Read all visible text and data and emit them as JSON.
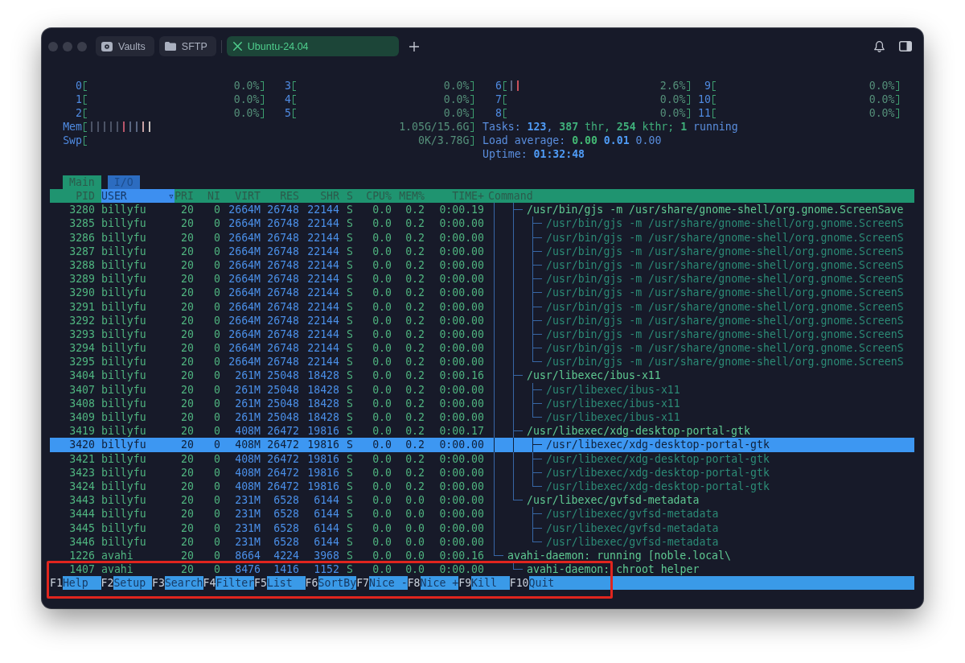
{
  "window": {
    "tabs": [
      {
        "label": "Vaults",
        "kind": "vaults",
        "selected": false
      },
      {
        "label": "SFTP",
        "kind": "sftp",
        "selected": false
      },
      {
        "label": "Ubuntu-24.04",
        "kind": "host",
        "selected": true
      }
    ]
  },
  "meters": {
    "cpus": [
      {
        "label": "0",
        "value": "0.0%"
      },
      {
        "label": "3",
        "value": "0.0%"
      },
      {
        "label": "6",
        "value": "2.6%",
        "bars": [
          {
            "color": "#5d6680"
          },
          {
            "color": "#c8505a"
          }
        ]
      },
      {
        "label": "9",
        "value": "0.0%"
      },
      {
        "label": "1",
        "value": "0.0%"
      },
      {
        "label": "4",
        "value": "0.0%"
      },
      {
        "label": "7",
        "value": "0.0%"
      },
      {
        "label": "10",
        "value": "0.0%"
      },
      {
        "label": "2",
        "value": "0.0%"
      },
      {
        "label": "5",
        "value": "0.0%"
      },
      {
        "label": "8",
        "value": "0.0%"
      },
      {
        "label": "11",
        "value": "0.0%"
      }
    ],
    "memory": {
      "label": "Mem",
      "value": "1.05G/15.6G",
      "bars": [
        {
          "color": "#4c5366"
        },
        {
          "color": "#4c5366"
        },
        {
          "color": "#4c5366"
        },
        {
          "color": "#4c5366"
        },
        {
          "color": "#4c5366"
        },
        {
          "color": "#b8556a"
        },
        {
          "color": "#5a6680"
        },
        {
          "color": "#5a6680"
        },
        {
          "color": "#c9a2a4"
        },
        {
          "color": "#c8c0bc"
        }
      ]
    },
    "swap": {
      "label": "Swp",
      "value": "0K/3.78G"
    }
  },
  "summary": [
    {
      "parts": [
        {
          "kind": "label",
          "text": "Tasks: "
        },
        {
          "kind": "total",
          "text": "123"
        },
        {
          "kind": "label",
          "text": ", "
        },
        {
          "kind": "threads",
          "text": "387"
        },
        {
          "kind": "threads_label",
          "text": " thr, "
        },
        {
          "kind": "threads",
          "text": "254"
        },
        {
          "kind": "threads_label",
          "text": " kthr; "
        },
        {
          "kind": "running",
          "text": "1"
        },
        {
          "kind": "label",
          "text": " running"
        }
      ]
    },
    {
      "parts": [
        {
          "kind": "label",
          "text": "Load average: "
        },
        {
          "kind": "load_high",
          "text": "0.00"
        },
        {
          "kind": "load_mid",
          "text": " 0.01"
        },
        {
          "kind": "load_low",
          "text": " 0.00"
        }
      ]
    },
    {
      "parts": [
        {
          "kind": "label",
          "text": "Uptime: "
        },
        {
          "kind": "total",
          "text": "01:32:48"
        }
      ]
    }
  ],
  "screen_tabs": [
    {
      "label": "Main",
      "selected": true
    },
    {
      "label": "I/O",
      "selected": false
    }
  ],
  "columns": [
    {
      "label": "PID",
      "sorted": false
    },
    {
      "label": "USER",
      "sorted": true,
      "sort_mark": "▿"
    },
    {
      "label": "PRI",
      "sorted": false
    },
    {
      "label": "NI",
      "sorted": false
    },
    {
      "label": "VIRT",
      "sorted": false
    },
    {
      "label": "RES",
      "sorted": false
    },
    {
      "label": "SHR",
      "sorted": false
    },
    {
      "label": "S",
      "sorted": false
    },
    {
      "label": "CPU%",
      "sorted": false
    },
    {
      "label": "MEM%",
      "sorted": false
    },
    {
      "label": "TIME+",
      "sorted": false
    },
    {
      "label": "Command",
      "sorted": false
    }
  ],
  "processes": [
    {
      "children": [
        {
          "pid": "3280",
          "user": "billyfu",
          "priority": "20",
          "nice": "0",
          "virt": "2664M",
          "res": "26748",
          "shr": "22144",
          "state": "S",
          "cpu": "0.0",
          "mem": "0.2",
          "time": "0:00.19",
          "command": "/usr/bin/gjs -m /usr/share/gnome-shell/org.gnome.ScreenSave",
          "thread": false,
          "selected": false,
          "children": [
            {
              "pid": "3285",
              "user": "billyfu",
              "priority": "20",
              "nice": "0",
              "virt": "2664M",
              "res": "26748",
              "shr": "22144",
              "state": "S",
              "cpu": "0.0",
              "mem": "0.2",
              "time": "0:00.00",
              "command": "/usr/bin/gjs -m /usr/share/gnome-shell/org.gnome.ScreenS",
              "thread": true,
              "selected": false
            },
            {
              "pid": "3286",
              "user": "billyfu",
              "priority": "20",
              "nice": "0",
              "virt": "2664M",
              "res": "26748",
              "shr": "22144",
              "state": "S",
              "cpu": "0.0",
              "mem": "0.2",
              "time": "0:00.00",
              "command": "/usr/bin/gjs -m /usr/share/gnome-shell/org.gnome.ScreenS",
              "thread": true,
              "selected": false
            },
            {
              "pid": "3287",
              "user": "billyfu",
              "priority": "20",
              "nice": "0",
              "virt": "2664M",
              "res": "26748",
              "shr": "22144",
              "state": "S",
              "cpu": "0.0",
              "mem": "0.2",
              "time": "0:00.00",
              "command": "/usr/bin/gjs -m /usr/share/gnome-shell/org.gnome.ScreenS",
              "thread": true,
              "selected": false
            },
            {
              "pid": "3288",
              "user": "billyfu",
              "priority": "20",
              "nice": "0",
              "virt": "2664M",
              "res": "26748",
              "shr": "22144",
              "state": "S",
              "cpu": "0.0",
              "mem": "0.2",
              "time": "0:00.00",
              "command": "/usr/bin/gjs -m /usr/share/gnome-shell/org.gnome.ScreenS",
              "thread": true,
              "selected": false
            },
            {
              "pid": "3289",
              "user": "billyfu",
              "priority": "20",
              "nice": "0",
              "virt": "2664M",
              "res": "26748",
              "shr": "22144",
              "state": "S",
              "cpu": "0.0",
              "mem": "0.2",
              "time": "0:00.00",
              "command": "/usr/bin/gjs -m /usr/share/gnome-shell/org.gnome.ScreenS",
              "thread": true,
              "selected": false
            },
            {
              "pid": "3290",
              "user": "billyfu",
              "priority": "20",
              "nice": "0",
              "virt": "2664M",
              "res": "26748",
              "shr": "22144",
              "state": "S",
              "cpu": "0.0",
              "mem": "0.2",
              "time": "0:00.00",
              "command": "/usr/bin/gjs -m /usr/share/gnome-shell/org.gnome.ScreenS",
              "thread": true,
              "selected": false
            },
            {
              "pid": "3291",
              "user": "billyfu",
              "priority": "20",
              "nice": "0",
              "virt": "2664M",
              "res": "26748",
              "shr": "22144",
              "state": "S",
              "cpu": "0.0",
              "mem": "0.2",
              "time": "0:00.00",
              "command": "/usr/bin/gjs -m /usr/share/gnome-shell/org.gnome.ScreenS",
              "thread": true,
              "selected": false
            },
            {
              "pid": "3292",
              "user": "billyfu",
              "priority": "20",
              "nice": "0",
              "virt": "2664M",
              "res": "26748",
              "shr": "22144",
              "state": "S",
              "cpu": "0.0",
              "mem": "0.2",
              "time": "0:00.00",
              "command": "/usr/bin/gjs -m /usr/share/gnome-shell/org.gnome.ScreenS",
              "thread": true,
              "selected": false
            },
            {
              "pid": "3293",
              "user": "billyfu",
              "priority": "20",
              "nice": "0",
              "virt": "2664M",
              "res": "26748",
              "shr": "22144",
              "state": "S",
              "cpu": "0.0",
              "mem": "0.2",
              "time": "0:00.00",
              "command": "/usr/bin/gjs -m /usr/share/gnome-shell/org.gnome.ScreenS",
              "thread": true,
              "selected": false
            },
            {
              "pid": "3294",
              "user": "billyfu",
              "priority": "20",
              "nice": "0",
              "virt": "2664M",
              "res": "26748",
              "shr": "22144",
              "state": "S",
              "cpu": "0.0",
              "mem": "0.2",
              "time": "0:00.00",
              "command": "/usr/bin/gjs -m /usr/share/gnome-shell/org.gnome.ScreenS",
              "thread": true,
              "selected": false
            },
            {
              "pid": "3295",
              "user": "billyfu",
              "priority": "20",
              "nice": "0",
              "virt": "2664M",
              "res": "26748",
              "shr": "22144",
              "state": "S",
              "cpu": "0.0",
              "mem": "0.2",
              "time": "0:00.00",
              "command": "/usr/bin/gjs -m /usr/share/gnome-shell/org.gnome.ScreenS",
              "thread": true,
              "selected": false
            }
          ]
        },
        {
          "pid": "3404",
          "user": "billyfu",
          "priority": "20",
          "nice": "0",
          "virt": "261M",
          "res": "25048",
          "shr": "18428",
          "state": "S",
          "cpu": "0.0",
          "mem": "0.2",
          "time": "0:00.16",
          "command": "/usr/libexec/ibus-x11",
          "thread": false,
          "selected": false,
          "children": [
            {
              "pid": "3407",
              "user": "billyfu",
              "priority": "20",
              "nice": "0",
              "virt": "261M",
              "res": "25048",
              "shr": "18428",
              "state": "S",
              "cpu": "0.0",
              "mem": "0.2",
              "time": "0:00.00",
              "command": "/usr/libexec/ibus-x11",
              "thread": true,
              "selected": false
            },
            {
              "pid": "3408",
              "user": "billyfu",
              "priority": "20",
              "nice": "0",
              "virt": "261M",
              "res": "25048",
              "shr": "18428",
              "state": "S",
              "cpu": "0.0",
              "mem": "0.2",
              "time": "0:00.00",
              "command": "/usr/libexec/ibus-x11",
              "thread": true,
              "selected": false
            },
            {
              "pid": "3409",
              "user": "billyfu",
              "priority": "20",
              "nice": "0",
              "virt": "261M",
              "res": "25048",
              "shr": "18428",
              "state": "S",
              "cpu": "0.0",
              "mem": "0.2",
              "time": "0:00.00",
              "command": "/usr/libexec/ibus-x11",
              "thread": true,
              "selected": false
            }
          ]
        },
        {
          "pid": "3419",
          "user": "billyfu",
          "priority": "20",
          "nice": "0",
          "virt": "408M",
          "res": "26472",
          "shr": "19816",
          "state": "S",
          "cpu": "0.0",
          "mem": "0.2",
          "time": "0:00.17",
          "command": "/usr/libexec/xdg-desktop-portal-gtk",
          "thread": false,
          "selected": false,
          "children": [
            {
              "pid": "3420",
              "user": "billyfu",
              "priority": "20",
              "nice": "0",
              "virt": "408M",
              "res": "26472",
              "shr": "19816",
              "state": "S",
              "cpu": "0.0",
              "mem": "0.2",
              "time": "0:00.00",
              "command": "/usr/libexec/xdg-desktop-portal-gtk",
              "thread": true,
              "selected": true
            },
            {
              "pid": "3421",
              "user": "billyfu",
              "priority": "20",
              "nice": "0",
              "virt": "408M",
              "res": "26472",
              "shr": "19816",
              "state": "S",
              "cpu": "0.0",
              "mem": "0.2",
              "time": "0:00.00",
              "command": "/usr/libexec/xdg-desktop-portal-gtk",
              "thread": true,
              "selected": false
            },
            {
              "pid": "3423",
              "user": "billyfu",
              "priority": "20",
              "nice": "0",
              "virt": "408M",
              "res": "26472",
              "shr": "19816",
              "state": "S",
              "cpu": "0.0",
              "mem": "0.2",
              "time": "0:00.00",
              "command": "/usr/libexec/xdg-desktop-portal-gtk",
              "thread": true,
              "selected": false
            },
            {
              "pid": "3424",
              "user": "billyfu",
              "priority": "20",
              "nice": "0",
              "virt": "408M",
              "res": "26472",
              "shr": "19816",
              "state": "S",
              "cpu": "0.0",
              "mem": "0.2",
              "time": "0:00.00",
              "command": "/usr/libexec/xdg-desktop-portal-gtk",
              "thread": true,
              "selected": false
            }
          ]
        },
        {
          "pid": "3443",
          "user": "billyfu",
          "priority": "20",
          "nice": "0",
          "virt": "231M",
          "res": "6528",
          "shr": "6144",
          "state": "S",
          "cpu": "0.0",
          "mem": "0.0",
          "time": "0:00.00",
          "command": "/usr/libexec/gvfsd-metadata",
          "thread": false,
          "selected": false,
          "children": [
            {
              "pid": "3444",
              "user": "billyfu",
              "priority": "20",
              "nice": "0",
              "virt": "231M",
              "res": "6528",
              "shr": "6144",
              "state": "S",
              "cpu": "0.0",
              "mem": "0.0",
              "time": "0:00.00",
              "command": "/usr/libexec/gvfsd-metadata",
              "thread": true,
              "selected": false
            },
            {
              "pid": "3445",
              "user": "billyfu",
              "priority": "20",
              "nice": "0",
              "virt": "231M",
              "res": "6528",
              "shr": "6144",
              "state": "S",
              "cpu": "0.0",
              "mem": "0.0",
              "time": "0:00.00",
              "command": "/usr/libexec/gvfsd-metadata",
              "thread": true,
              "selected": false
            },
            {
              "pid": "3446",
              "user": "billyfu",
              "priority": "20",
              "nice": "0",
              "virt": "231M",
              "res": "6528",
              "shr": "6144",
              "state": "S",
              "cpu": "0.0",
              "mem": "0.0",
              "time": "0:00.00",
              "command": "/usr/libexec/gvfsd-metadata",
              "thread": true,
              "selected": false
            }
          ]
        }
      ]
    },
    {
      "pid": "1226",
      "user": "avahi",
      "priority": "20",
      "nice": "0",
      "virt": "8664",
      "res": "4224",
      "shr": "3968",
      "state": "S",
      "cpu": "0.0",
      "mem": "0.0",
      "time": "0:00.16",
      "command": "avahi-daemon: running [noble.local\\",
      "thread": false,
      "selected": false,
      "children": [
        {
          "pid": "1407",
          "user": "avahi",
          "priority": "20",
          "nice": "0",
          "virt": "8476",
          "res": "1416",
          "shr": "1152",
          "state": "S",
          "cpu": "0.0",
          "mem": "0.0",
          "time": "0:00.00",
          "command": "avahi-daemon: chroot helper",
          "thread": false,
          "selected": false
        }
      ]
    }
  ],
  "function_bar": {
    "highlighted": true,
    "keys": [
      {
        "key": "F1",
        "label": "Help"
      },
      {
        "key": "F2",
        "label": "Setup"
      },
      {
        "key": "F3",
        "label": "Search"
      },
      {
        "key": "F4",
        "label": "Filter"
      },
      {
        "key": "F5",
        "label": "List"
      },
      {
        "key": "F6",
        "label": "SortBy"
      },
      {
        "key": "F7",
        "label": "Nice -"
      },
      {
        "key": "F8",
        "label": "Nice +"
      },
      {
        "key": "F9",
        "label": "Kill"
      },
      {
        "key": "F10",
        "label": "Quit"
      }
    ]
  }
}
